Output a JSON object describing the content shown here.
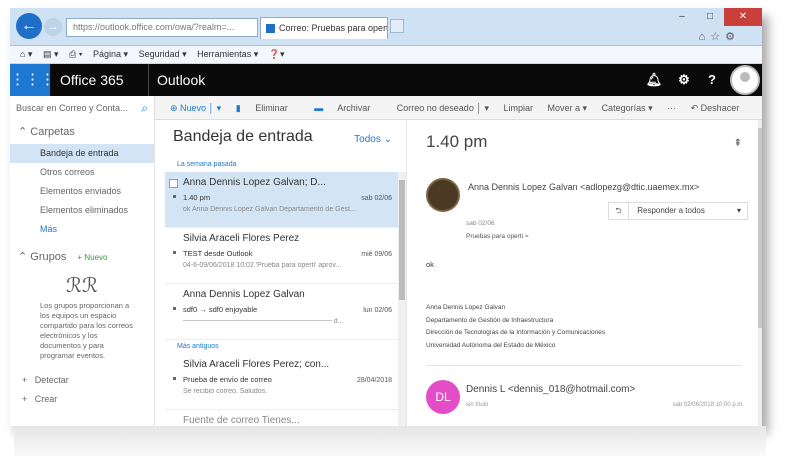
{
  "browser": {
    "address": "https://outlook.office.com/owa/?realm=...",
    "tab_title": "Correo: Pruebas para operti...",
    "command_bar": [
      "Página ▾",
      "Seguridad ▾",
      "Herramientas ▾"
    ],
    "window_controls": [
      "–",
      "□",
      "✕"
    ]
  },
  "o365": {
    "brand": "Office 365",
    "app": "Outlook"
  },
  "toolbar": {
    "search_placeholder": "Buscar en Correo y Conta...",
    "new": "⊕ Nuevo │ ▾",
    "delete": "Eliminar",
    "archive": "Archivar",
    "junk": "Correo no deseado │ ▾",
    "clean": "Limpiar",
    "move": "Mover a ▾",
    "categories": "Categorías ▾",
    "more": "···",
    "undo": "↶ Deshacer"
  },
  "sidebar": {
    "folders_header": "Carpetas",
    "folders": [
      "Bandeja de entrada",
      "Otros correos",
      "Elementos enviados",
      "Elementos eliminados",
      "Más"
    ],
    "groups_header": "Grupos",
    "groups_new": "+ Nuevo",
    "groups_text": "Los grupos proporcionan a los equipos un espacio compartido para los correos electrónicos y los documentos y para programar eventos.",
    "bottom": [
      "Detectar",
      "Crear"
    ]
  },
  "list": {
    "title": "Bandeja de entrada",
    "filter": "Todos ⌄",
    "group_this_week": "La semana pasada",
    "group_older": "Más antiguos",
    "messages": [
      {
        "from": "Anna Dennis Lopez Galvan; D...",
        "subject": "1.40 pm",
        "time": "sab 02/06",
        "preview": "ok Anna Dennis Lopez Galvan Departamento de Gest..."
      },
      {
        "from": "Silvia Araceli Flores Perez",
        "subject": "TEST desde Outlook",
        "time": "mié 09/06",
        "preview": "04-6-09/06/2018 10:02 'Prueba para operti' aprov..."
      },
      {
        "from": "Anna Dennis Lopez Galvan",
        "subject": "sdf0 → sdf0 enjoyable",
        "time": "lun 02/06",
        "preview": "────────────────────────────── d..."
      },
      {
        "from": "Silvia Araceli Flores Perez; con...",
        "subject": "Prueba de envío de correo",
        "time": "28/04/2018",
        "preview": "Se recibió correo. Saludos."
      }
    ],
    "partial_item": "Fuente de correo Tienes..."
  },
  "reading": {
    "subject": "1.40 pm",
    "pin": "⇞",
    "from": "Anna Dennis Lopez Galvan <adlopezg@dtic.uaemex.mx>",
    "reply_all": "Responder a todos",
    "date": "sab 02/06",
    "to": "Pruebas para operti  ≈",
    "body": "ok",
    "signature": [
      "Anna Dennis Lopez Galvan",
      "Departamento de Gestión de Infraestructura",
      "Dirección de Tecnologías de la Información y Comunicaciones",
      "Universidad Autónoma del Estado de México"
    ],
    "second_initials": "DL",
    "second_from": "Dennis L <dennis_018@hotmail.com>",
    "second_sub": "sin título",
    "second_date": "sab 02/06/2018 10:00 p.m."
  },
  "colors": {
    "accent": "#1e77d0",
    "o365_bar": "#0a0a0a",
    "selected_row": "#d3e4f5",
    "dl_avatar": "#e34dc7"
  }
}
